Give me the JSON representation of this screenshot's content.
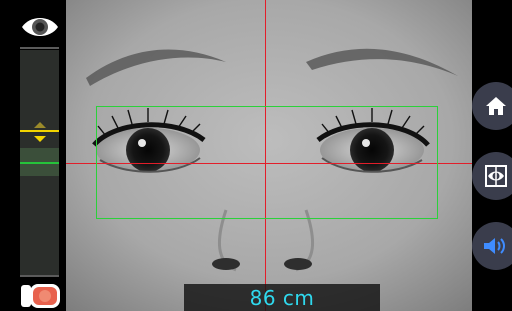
{
  "distance": {
    "value": "86 cm"
  },
  "colors": {
    "crosshair": "#e21e2a",
    "eye_box": "#2bd13a",
    "distance_text": "#2fd9ee",
    "slider_yellow": "#f2d400",
    "slider_green": "#25c33a",
    "button_bg": "#3a3d4c"
  },
  "icons": {
    "top_left": "eye-icon",
    "slider_marker": "yellow-double-chevron-icon",
    "bottom_left": "camera-switch-icon",
    "right_buttons": [
      "home-icon",
      "eye-in-frame-icon",
      "speaker-icon"
    ]
  }
}
